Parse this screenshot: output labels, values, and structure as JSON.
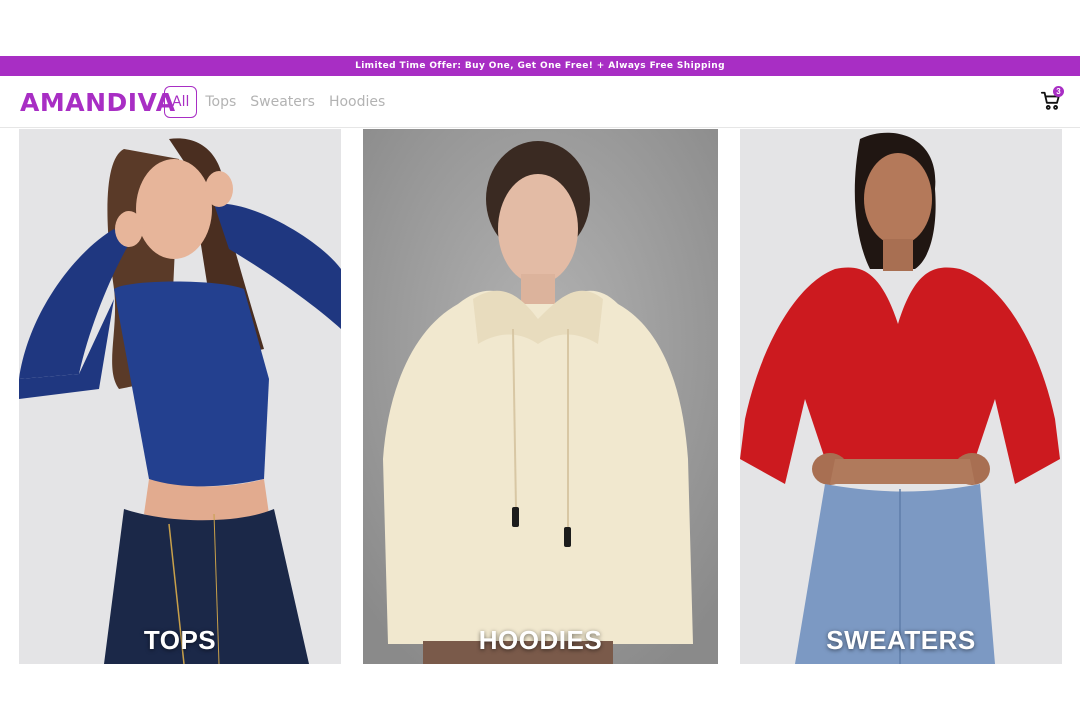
{
  "promo": {
    "text": "Limited Time Offer: Buy One, Get One Free! + Always Free Shipping"
  },
  "header": {
    "logo": "AMANDIVA",
    "nav": [
      {
        "label": "All",
        "active": true
      },
      {
        "label": "Tops",
        "active": false
      },
      {
        "label": "Sweaters",
        "active": false
      },
      {
        "label": "Hoodies",
        "active": false
      }
    ],
    "cart": {
      "icon": "cart-icon",
      "count": "3"
    }
  },
  "categories": [
    {
      "label": "TOPS",
      "image": "model-in-navy-long-sleeve-crop-top-and-dark-jeans"
    },
    {
      "label": "HOODIES",
      "image": "model-in-cream-cropped-hoodie"
    },
    {
      "label": "SWEATERS",
      "image": "model-in-red-v-neck-crop-sweater-and-light-jeans"
    }
  ],
  "colors": {
    "brand": "#a82ec4",
    "nav_inactive": "#b3b3b3",
    "photo_bg_light": "#e4e4e6",
    "photo_bg_gray": "#9a9a9a"
  }
}
